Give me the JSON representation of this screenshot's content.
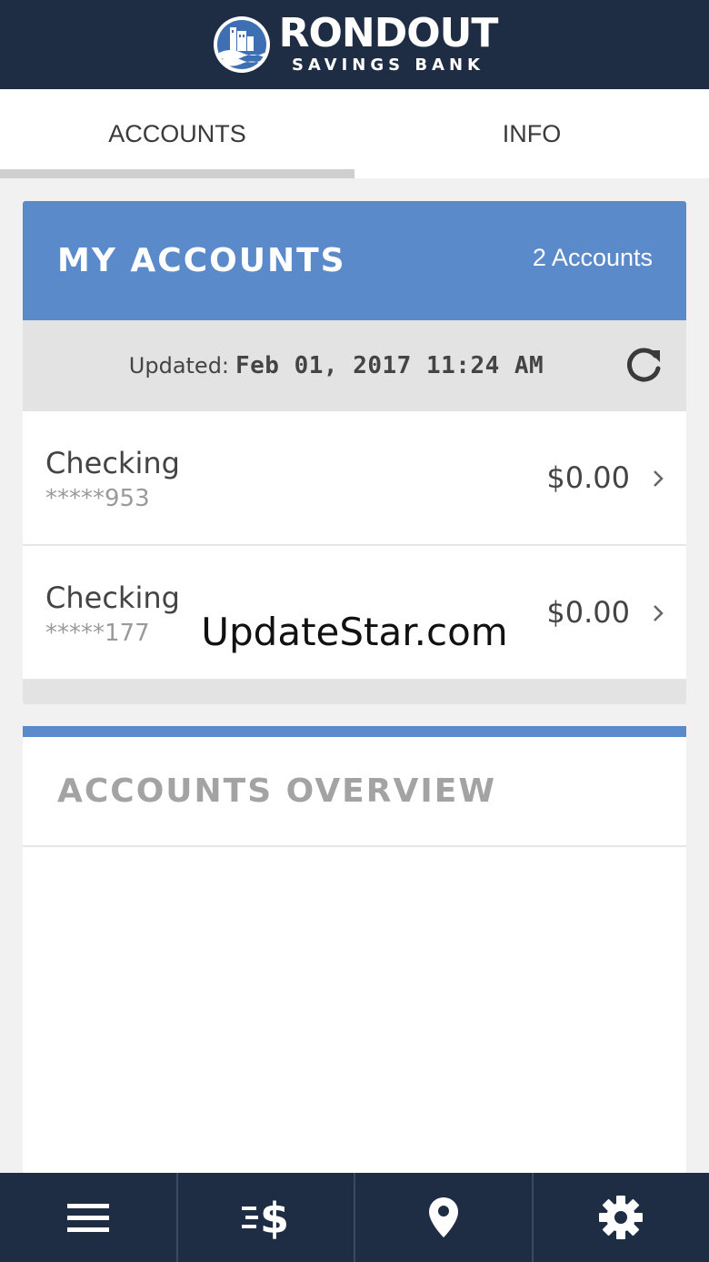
{
  "header": {
    "brand_name": "RONDOUT",
    "brand_sub": "SAVINGS BANK"
  },
  "tabs": [
    {
      "label": "ACCOUNTS",
      "active": true
    },
    {
      "label": "INFO",
      "active": false
    }
  ],
  "accounts_card": {
    "title": "MY ACCOUNTS",
    "count": "2 Accounts",
    "updated_label": "Updated:",
    "updated_value": "Feb 01, 2017 11:24 AM",
    "accounts": [
      {
        "name": "Checking",
        "number": "*****953",
        "balance": "$0.00"
      },
      {
        "name": "Checking",
        "number": "*****177",
        "balance": "$0.00"
      }
    ]
  },
  "overview": {
    "title": "ACCOUNTS OVERVIEW"
  },
  "watermark": "UpdateStar.com",
  "bottom_nav": [
    {
      "icon": "menu-icon"
    },
    {
      "icon": "transfer-money-icon"
    },
    {
      "icon": "location-pin-icon"
    },
    {
      "icon": "gear-icon"
    }
  ],
  "colors": {
    "header_bg": "#1f2d44",
    "accent_blue": "#5a8ac9",
    "gray_bar": "#e3e3e3"
  }
}
